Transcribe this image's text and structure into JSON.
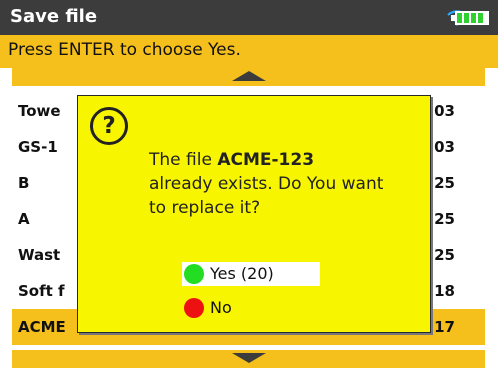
{
  "titlebar": {
    "title": "Save file",
    "wifi_icon": "wifi-icon",
    "battery_icon": "battery-icon"
  },
  "hint": {
    "text": "Press ENTER to choose Yes."
  },
  "list": {
    "rows": [
      {
        "name": "Towe",
        "value": "03"
      },
      {
        "name": "GS-1",
        "value": "03"
      },
      {
        "name": "B",
        "value": "25"
      },
      {
        "name": "A",
        "value": "25"
      },
      {
        "name": "Wast",
        "value": "25"
      },
      {
        "name": "Soft f",
        "value": "18"
      },
      {
        "name": "ACME",
        "value": "17"
      }
    ],
    "selected_index": 6
  },
  "dialog": {
    "icon": "question-icon",
    "message_before": "The file ",
    "filename": "ACME-123",
    "message_after": "already exists. Do You want to replace it?",
    "yes_label": "Yes (20)",
    "no_label": "No",
    "yes_color": "#22dd22",
    "no_color": "#ee1111"
  },
  "colors": {
    "accent": "#f5c01c",
    "dialog_bg": "#f8f500",
    "titlebar": "#3c3c3c"
  }
}
